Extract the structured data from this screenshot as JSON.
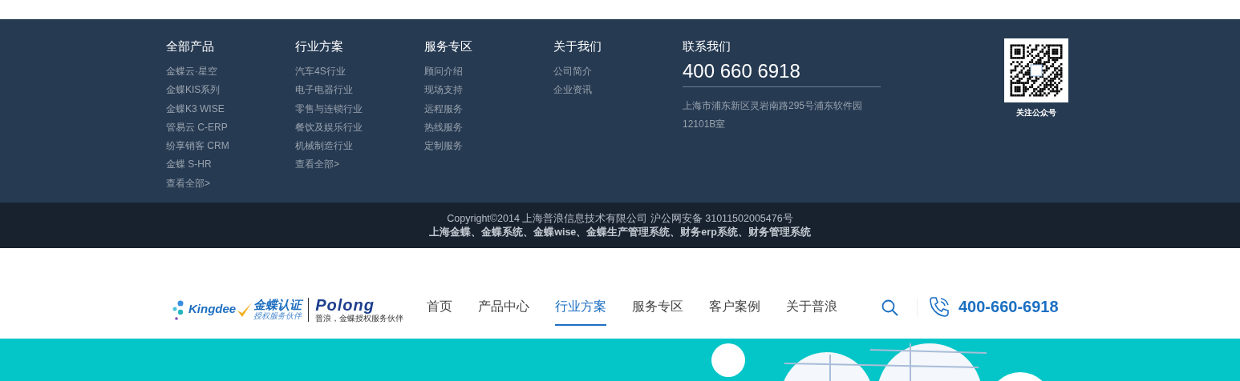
{
  "footer": {
    "columns": [
      {
        "heading": "全部产品",
        "links": [
          "金蝶云·星空",
          "金蝶KIS系列",
          "金蝶K3 WISE",
          "管易云 C-ERP",
          "纷享销客 CRM",
          "金蝶 S-HR",
          "查看全部>"
        ]
      },
      {
        "heading": "行业方案",
        "links": [
          "汽车4S行业",
          "电子电器行业",
          "零售与连锁行业",
          "餐饮及娱乐行业",
          "机械制造行业",
          "查看全部>"
        ]
      },
      {
        "heading": "服务专区",
        "links": [
          "顾问介绍",
          "现场支持",
          "远程服务",
          "热线服务",
          "定制服务"
        ]
      },
      {
        "heading": "关于我们",
        "links": [
          "公司简介",
          "企业资讯"
        ]
      }
    ],
    "contact": {
      "heading": "联系我们",
      "phone": "400 660 6918",
      "address_lines": [
        "上海市浦东新区灵岩南路295号浦东软件园",
        "12101B室"
      ]
    },
    "qr": {
      "caption": "关注公众号"
    }
  },
  "copyright": {
    "line_1": "Copyright©2014 上海普浪信息技术有限公司 沪公网安备 31011502005476号",
    "line_2": "上海金蝶、金蝶系统、金蝶wise、金蝶生产管理系统、财务erp系统、财务管理系统"
  },
  "nav": {
    "logo": {
      "brand": "Kingdee",
      "cert": "金蝶认证",
      "cert_sub": "授权服务伙伴",
      "partner": "Polong",
      "partner_sub": "普浪，金蝶授权服务伙伴"
    },
    "items": [
      {
        "label": "首页",
        "selected": false
      },
      {
        "label": "产品中心",
        "selected": false
      },
      {
        "label": "行业方案",
        "selected": true
      },
      {
        "label": "服务专区",
        "selected": false
      },
      {
        "label": "客户案例",
        "selected": false
      },
      {
        "label": "关于普浪",
        "selected": false
      }
    ],
    "phone": "400-660-6918"
  }
}
